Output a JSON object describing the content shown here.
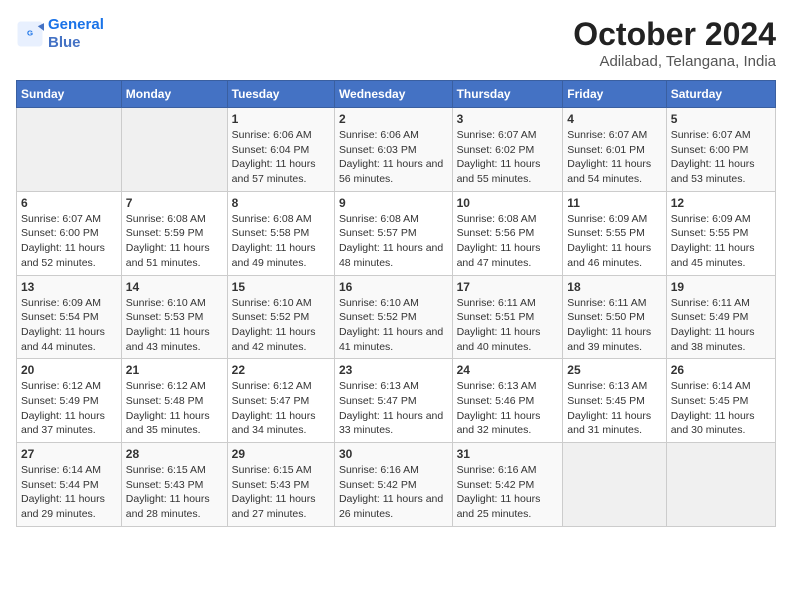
{
  "logo": {
    "line1": "General",
    "line2": "Blue"
  },
  "title": "October 2024",
  "subtitle": "Adilabad, Telangana, India",
  "days_of_week": [
    "Sunday",
    "Monday",
    "Tuesday",
    "Wednesday",
    "Thursday",
    "Friday",
    "Saturday"
  ],
  "weeks": [
    [
      {
        "day": "",
        "sunrise": "",
        "sunset": "",
        "daylight": ""
      },
      {
        "day": "",
        "sunrise": "",
        "sunset": "",
        "daylight": ""
      },
      {
        "day": "1",
        "sunrise": "Sunrise: 6:06 AM",
        "sunset": "Sunset: 6:04 PM",
        "daylight": "Daylight: 11 hours and 57 minutes."
      },
      {
        "day": "2",
        "sunrise": "Sunrise: 6:06 AM",
        "sunset": "Sunset: 6:03 PM",
        "daylight": "Daylight: 11 hours and 56 minutes."
      },
      {
        "day": "3",
        "sunrise": "Sunrise: 6:07 AM",
        "sunset": "Sunset: 6:02 PM",
        "daylight": "Daylight: 11 hours and 55 minutes."
      },
      {
        "day": "4",
        "sunrise": "Sunrise: 6:07 AM",
        "sunset": "Sunset: 6:01 PM",
        "daylight": "Daylight: 11 hours and 54 minutes."
      },
      {
        "day": "5",
        "sunrise": "Sunrise: 6:07 AM",
        "sunset": "Sunset: 6:00 PM",
        "daylight": "Daylight: 11 hours and 53 minutes."
      }
    ],
    [
      {
        "day": "6",
        "sunrise": "Sunrise: 6:07 AM",
        "sunset": "Sunset: 6:00 PM",
        "daylight": "Daylight: 11 hours and 52 minutes."
      },
      {
        "day": "7",
        "sunrise": "Sunrise: 6:08 AM",
        "sunset": "Sunset: 5:59 PM",
        "daylight": "Daylight: 11 hours and 51 minutes."
      },
      {
        "day": "8",
        "sunrise": "Sunrise: 6:08 AM",
        "sunset": "Sunset: 5:58 PM",
        "daylight": "Daylight: 11 hours and 49 minutes."
      },
      {
        "day": "9",
        "sunrise": "Sunrise: 6:08 AM",
        "sunset": "Sunset: 5:57 PM",
        "daylight": "Daylight: 11 hours and 48 minutes."
      },
      {
        "day": "10",
        "sunrise": "Sunrise: 6:08 AM",
        "sunset": "Sunset: 5:56 PM",
        "daylight": "Daylight: 11 hours and 47 minutes."
      },
      {
        "day": "11",
        "sunrise": "Sunrise: 6:09 AM",
        "sunset": "Sunset: 5:55 PM",
        "daylight": "Daylight: 11 hours and 46 minutes."
      },
      {
        "day": "12",
        "sunrise": "Sunrise: 6:09 AM",
        "sunset": "Sunset: 5:55 PM",
        "daylight": "Daylight: 11 hours and 45 minutes."
      }
    ],
    [
      {
        "day": "13",
        "sunrise": "Sunrise: 6:09 AM",
        "sunset": "Sunset: 5:54 PM",
        "daylight": "Daylight: 11 hours and 44 minutes."
      },
      {
        "day": "14",
        "sunrise": "Sunrise: 6:10 AM",
        "sunset": "Sunset: 5:53 PM",
        "daylight": "Daylight: 11 hours and 43 minutes."
      },
      {
        "day": "15",
        "sunrise": "Sunrise: 6:10 AM",
        "sunset": "Sunset: 5:52 PM",
        "daylight": "Daylight: 11 hours and 42 minutes."
      },
      {
        "day": "16",
        "sunrise": "Sunrise: 6:10 AM",
        "sunset": "Sunset: 5:52 PM",
        "daylight": "Daylight: 11 hours and 41 minutes."
      },
      {
        "day": "17",
        "sunrise": "Sunrise: 6:11 AM",
        "sunset": "Sunset: 5:51 PM",
        "daylight": "Daylight: 11 hours and 40 minutes."
      },
      {
        "day": "18",
        "sunrise": "Sunrise: 6:11 AM",
        "sunset": "Sunset: 5:50 PM",
        "daylight": "Daylight: 11 hours and 39 minutes."
      },
      {
        "day": "19",
        "sunrise": "Sunrise: 6:11 AM",
        "sunset": "Sunset: 5:49 PM",
        "daylight": "Daylight: 11 hours and 38 minutes."
      }
    ],
    [
      {
        "day": "20",
        "sunrise": "Sunrise: 6:12 AM",
        "sunset": "Sunset: 5:49 PM",
        "daylight": "Daylight: 11 hours and 37 minutes."
      },
      {
        "day": "21",
        "sunrise": "Sunrise: 6:12 AM",
        "sunset": "Sunset: 5:48 PM",
        "daylight": "Daylight: 11 hours and 35 minutes."
      },
      {
        "day": "22",
        "sunrise": "Sunrise: 6:12 AM",
        "sunset": "Sunset: 5:47 PM",
        "daylight": "Daylight: 11 hours and 34 minutes."
      },
      {
        "day": "23",
        "sunrise": "Sunrise: 6:13 AM",
        "sunset": "Sunset: 5:47 PM",
        "daylight": "Daylight: 11 hours and 33 minutes."
      },
      {
        "day": "24",
        "sunrise": "Sunrise: 6:13 AM",
        "sunset": "Sunset: 5:46 PM",
        "daylight": "Daylight: 11 hours and 32 minutes."
      },
      {
        "day": "25",
        "sunrise": "Sunrise: 6:13 AM",
        "sunset": "Sunset: 5:45 PM",
        "daylight": "Daylight: 11 hours and 31 minutes."
      },
      {
        "day": "26",
        "sunrise": "Sunrise: 6:14 AM",
        "sunset": "Sunset: 5:45 PM",
        "daylight": "Daylight: 11 hours and 30 minutes."
      }
    ],
    [
      {
        "day": "27",
        "sunrise": "Sunrise: 6:14 AM",
        "sunset": "Sunset: 5:44 PM",
        "daylight": "Daylight: 11 hours and 29 minutes."
      },
      {
        "day": "28",
        "sunrise": "Sunrise: 6:15 AM",
        "sunset": "Sunset: 5:43 PM",
        "daylight": "Daylight: 11 hours and 28 minutes."
      },
      {
        "day": "29",
        "sunrise": "Sunrise: 6:15 AM",
        "sunset": "Sunset: 5:43 PM",
        "daylight": "Daylight: 11 hours and 27 minutes."
      },
      {
        "day": "30",
        "sunrise": "Sunrise: 6:16 AM",
        "sunset": "Sunset: 5:42 PM",
        "daylight": "Daylight: 11 hours and 26 minutes."
      },
      {
        "day": "31",
        "sunrise": "Sunrise: 6:16 AM",
        "sunset": "Sunset: 5:42 PM",
        "daylight": "Daylight: 11 hours and 25 minutes."
      },
      {
        "day": "",
        "sunrise": "",
        "sunset": "",
        "daylight": ""
      },
      {
        "day": "",
        "sunrise": "",
        "sunset": "",
        "daylight": ""
      }
    ]
  ]
}
